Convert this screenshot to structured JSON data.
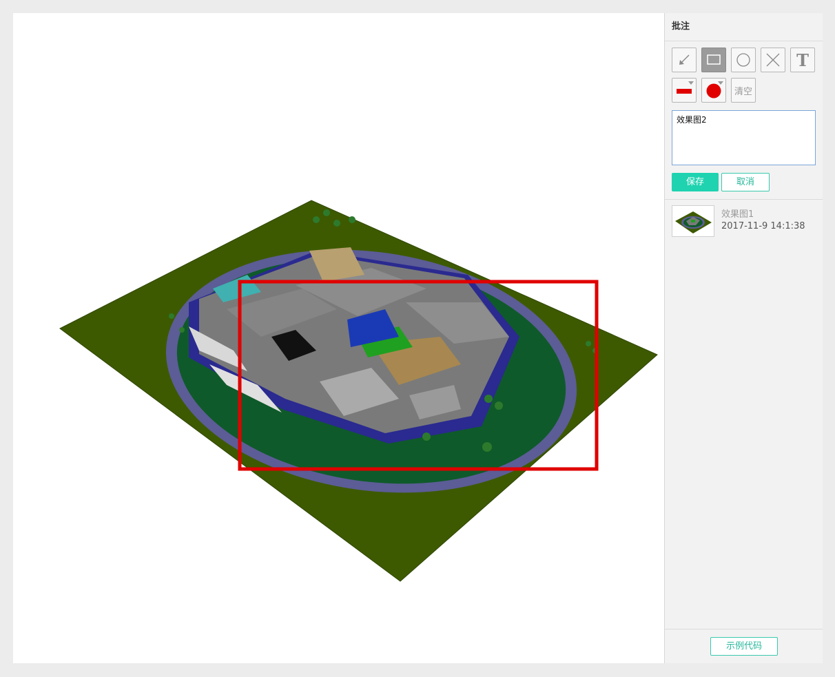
{
  "panel": {
    "title": "批注",
    "tools": [
      {
        "id": "arrow",
        "icon": "arrow-icon",
        "active": false
      },
      {
        "id": "rectangle",
        "icon": "rectangle-icon",
        "active": true
      },
      {
        "id": "circle",
        "icon": "circle-icon",
        "active": false
      },
      {
        "id": "cross",
        "icon": "cross-icon",
        "active": false
      },
      {
        "id": "text",
        "icon": "text-icon",
        "label": "T",
        "active": false
      }
    ],
    "line_style": {
      "icon": "line-color-icon",
      "color": "#e00000"
    },
    "fill_color": {
      "icon": "fill-color-icon",
      "color": "#e00000"
    },
    "clear_label": "清空",
    "note_value": "效果图2",
    "save_label": "保存",
    "cancel_label": "取消",
    "annotations": [
      {
        "name": "效果图1",
        "time": "2017-11-9 14:1:38"
      }
    ],
    "sample_code_label": "示例代码"
  },
  "colors": {
    "accent": "#1fd3b0",
    "annotation_stroke": "#e00000"
  }
}
